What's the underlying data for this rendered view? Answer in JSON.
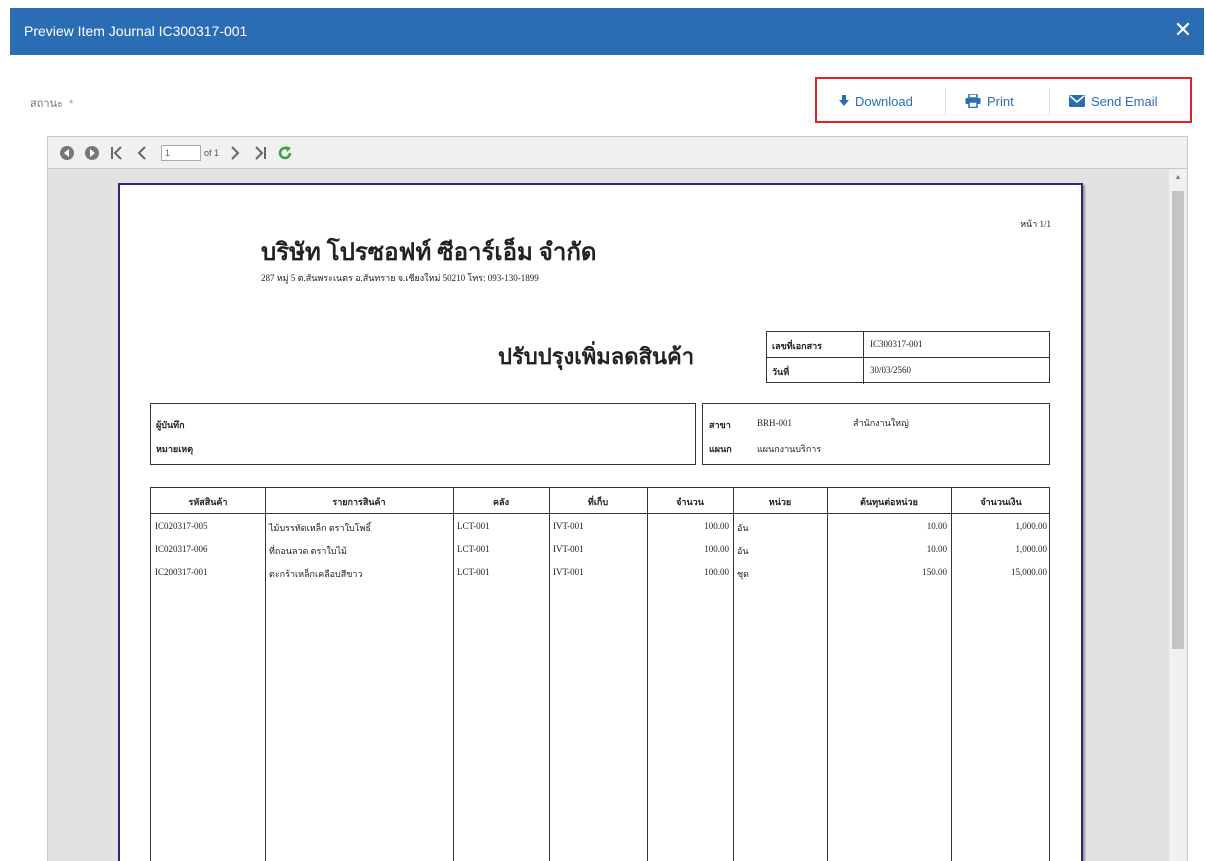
{
  "window": {
    "title": "Preview Item Journal IC300317-001",
    "close_icon": "close-icon"
  },
  "status": {
    "label": "สถานะ",
    "marker": "*"
  },
  "actions": {
    "download": "Download",
    "print": "Print",
    "send_email": "Send Email",
    "highlight_color": "#e3222b",
    "accent_color": "#2a6db5"
  },
  "toolbar": {
    "page_value": "1",
    "page_of": "of 1"
  },
  "report": {
    "page_label": "หน้า 1/1",
    "company_name": "บริษัท โปรซอฟท์ ซีอาร์เอ็ม จำกัด",
    "company_address": "287 หมู่ 5 ต.สันพระเนตร อ.สันทราย จ.เชียงใหม่ 50210 โทร: 093-130-1899",
    "doc_title": "ปรับปรุงเพิ่มลดสินค้า",
    "doc_no_label": "เลขที่เอกสาร",
    "doc_no_value": "IC300317-001",
    "date_label": "วันที่",
    "date_value": "30/03/2560",
    "recorder_label": "ผู้บันทึก",
    "note_label": "หมายเหตุ",
    "branch_label": "สาขา",
    "branch_code": "BRH-001",
    "branch_name": "สำนักงานใหญ่",
    "dept_label": "แผนก",
    "dept_name": "แผนกงานบริการ",
    "columns": [
      "รหัสสินค้า",
      "รายการสินค้า",
      "คลัง",
      "ที่เก็บ",
      "จำนวน",
      "หน่วย",
      "ต้นทุนต่อหน่วย",
      "จำนวนเงิน"
    ],
    "rows": [
      {
        "code": "IC020317-005",
        "name": "ไม้บรรทัดเหล็ก ตราใบโพธิ์",
        "wh": "LCT-001",
        "loc": "IVT-001",
        "qty": "100.00",
        "unit": "อัน",
        "cost": "10.00",
        "amount": "1,000.00"
      },
      {
        "code": "IC020317-006",
        "name": "ที่ถอนลวด ตราใบไม้",
        "wh": "LCT-001",
        "loc": "IVT-001",
        "qty": "100.00",
        "unit": "อัน",
        "cost": "10.00",
        "amount": "1,000.00"
      },
      {
        "code": "IC200317-001",
        "name": "ตะกร้าเหล็กเคลือบสีขาว",
        "wh": "LCT-001",
        "loc": "IVT-001",
        "qty": "100.00",
        "unit": "ชุด",
        "cost": "150.00",
        "amount": "15,000.00"
      }
    ]
  }
}
